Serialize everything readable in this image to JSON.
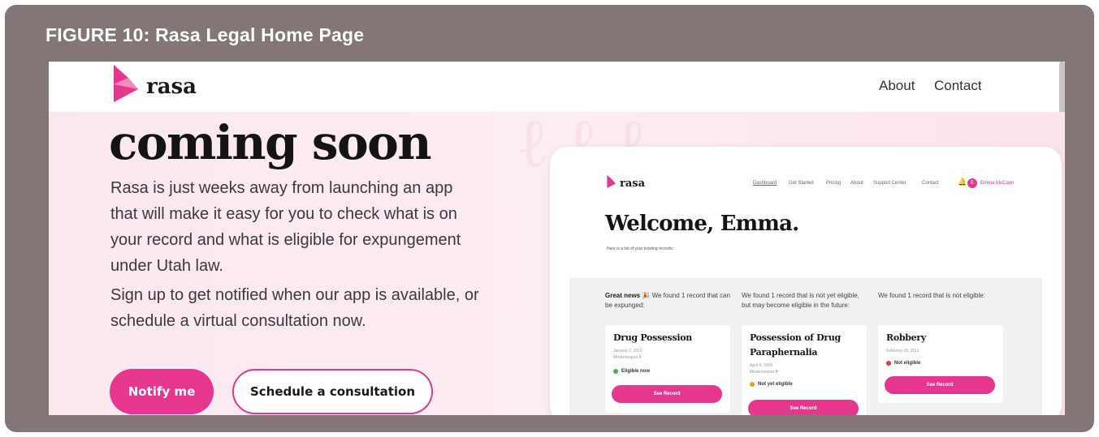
{
  "figure": {
    "caption": "FIGURE 10: Rasa Legal Home Page"
  },
  "site": {
    "brand": "rasa",
    "nav": [
      {
        "label": "About"
      },
      {
        "label": "Contact"
      }
    ],
    "hero": {
      "headline": "coming soon",
      "paragraph1": "Rasa is just weeks away from launching an app that will make it easy for you to check what is on your record and what is eligible for expungement under Utah law.",
      "paragraph2": "Sign up to get notified when our app is available, or schedule a virtual consultation now.",
      "primary_button": "Notify me",
      "secondary_button": "Schedule a consultation"
    }
  },
  "mockup": {
    "brand": "rasa",
    "nav": [
      "Dashboard",
      "Get Started",
      "Pricing",
      "About",
      "Support Center",
      "Contact"
    ],
    "user_initial": "E",
    "user_name": "Emma McCann",
    "welcome": "Welcome, Emma.",
    "subtitle": "Here is a list of your existing records:",
    "columns": [
      {
        "intro_bold": "Great news",
        "intro": "We found 1 record that can be expunged:",
        "card": {
          "title": "Drug Possession",
          "date": "January 2, 2010",
          "level": "Misdemeanor A",
          "status": "Eligible now",
          "status_color": "#4caf50",
          "button": "See Record"
        }
      },
      {
        "intro_bold": "",
        "intro": "We found 1 record that is not yet eligible, but may become eligible in the future:",
        "card": {
          "title": "Possession of Drug Paraphernalia",
          "date": "April 4, 2009",
          "level": "Misdemeanor B",
          "status": "Not yet eligible",
          "status_color": "#f0a020",
          "button": "See Record"
        }
      },
      {
        "intro_bold": "",
        "intro": "We found 1 record that is not eligible:",
        "card": {
          "title": "Robbery",
          "date": "February 29, 2011",
          "level": "",
          "status": "Not eligible",
          "status_color": "#e53935",
          "button": "See Record"
        }
      }
    ]
  },
  "colors": {
    "brand_pink": "#e6378f",
    "frame": "#827774"
  }
}
